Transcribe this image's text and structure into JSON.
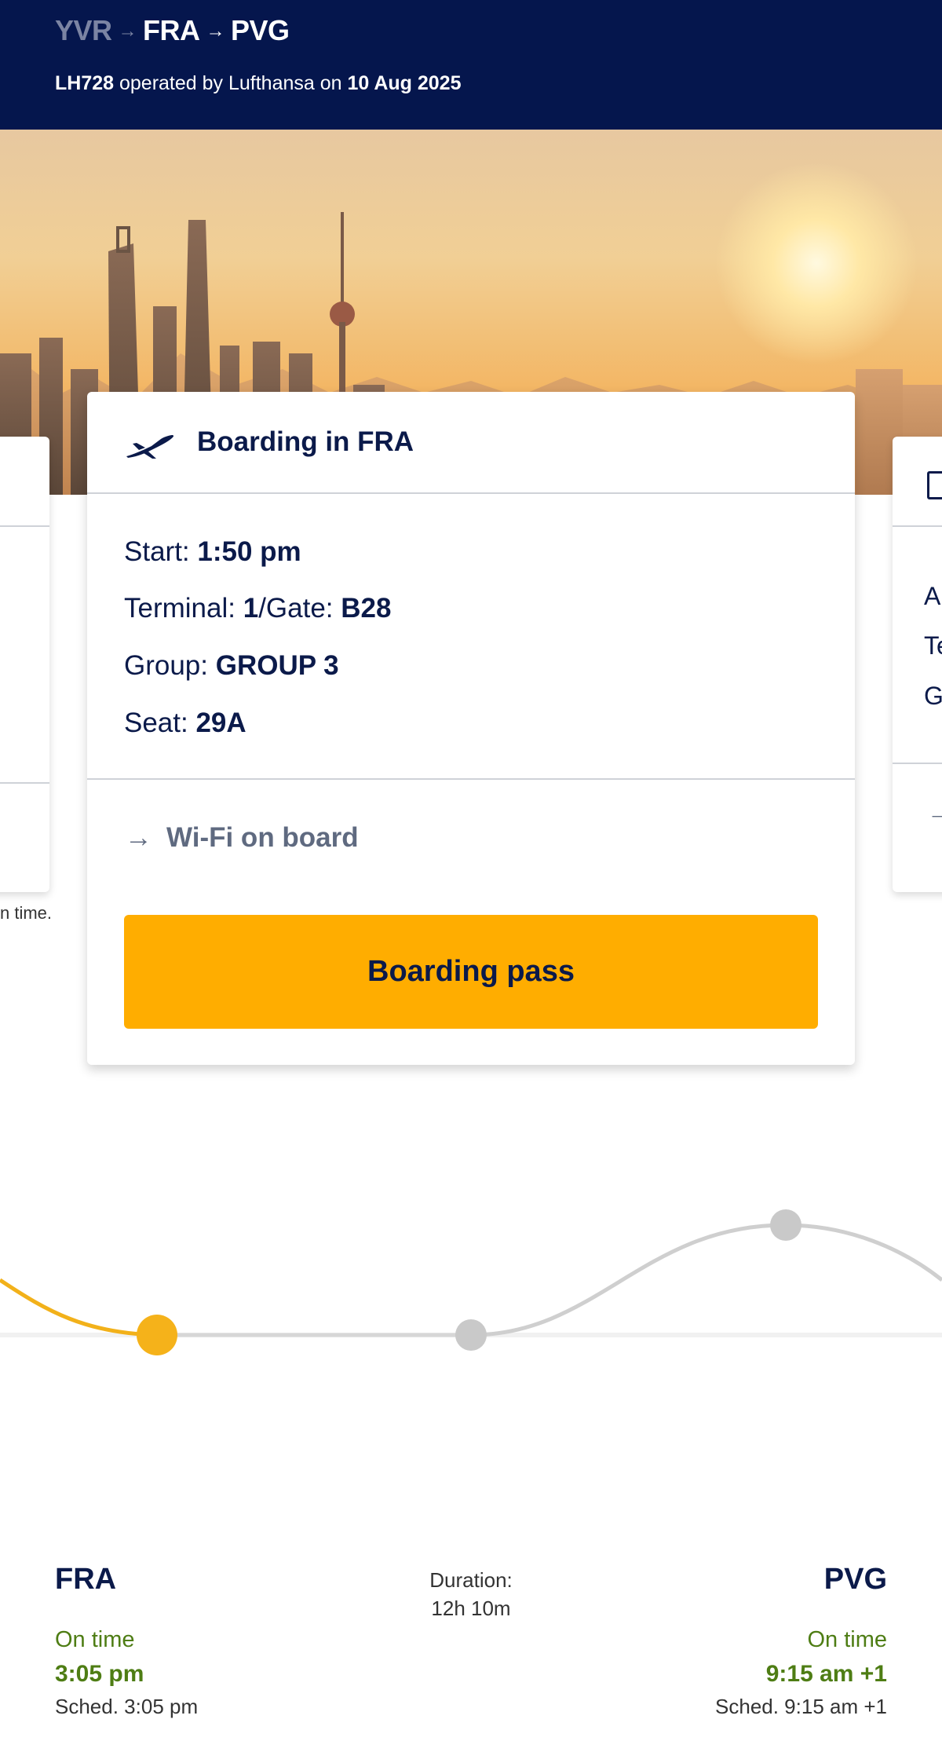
{
  "header": {
    "route_origin": "YVR",
    "route_via": "FRA",
    "route_dest": "PVG",
    "flight_number": "LH728",
    "operated_text": " operated by Lufthansa on ",
    "date": "10 Aug 2025"
  },
  "boarding_card": {
    "title": "Boarding in FRA",
    "start_label": "Start: ",
    "start_value": "1:50 pm",
    "terminal_label": "Terminal: ",
    "terminal_value": "1",
    "gate_label": "/Gate: ",
    "gate_value": "B28",
    "group_label": "Group: ",
    "group_value": "GROUP 3",
    "seat_label": "Seat: ",
    "seat_value": "29A",
    "wifi_link": "Wi-Fi on board",
    "boarding_pass_button": "Boarding pass"
  },
  "left_card": {
    "note": "n time."
  },
  "right_card": {
    "line1": "A",
    "line2": "Te",
    "line3": "G"
  },
  "flight_info": {
    "origin": "FRA",
    "origin_status": "On time",
    "origin_time": "3:05 pm",
    "origin_sched": "Sched. 3:05 pm",
    "duration_label": "Duration:",
    "duration_value": "12h 10m",
    "destination": "PVG",
    "destination_status": "On time",
    "destination_time": "9:15 am +1",
    "destination_sched": "Sched. 9:15 am +1"
  },
  "colors": {
    "brand_navy": "#05164d",
    "accent_yellow": "#ffad00",
    "status_green": "#4e7d14",
    "track_gray": "#c8c8c8"
  }
}
